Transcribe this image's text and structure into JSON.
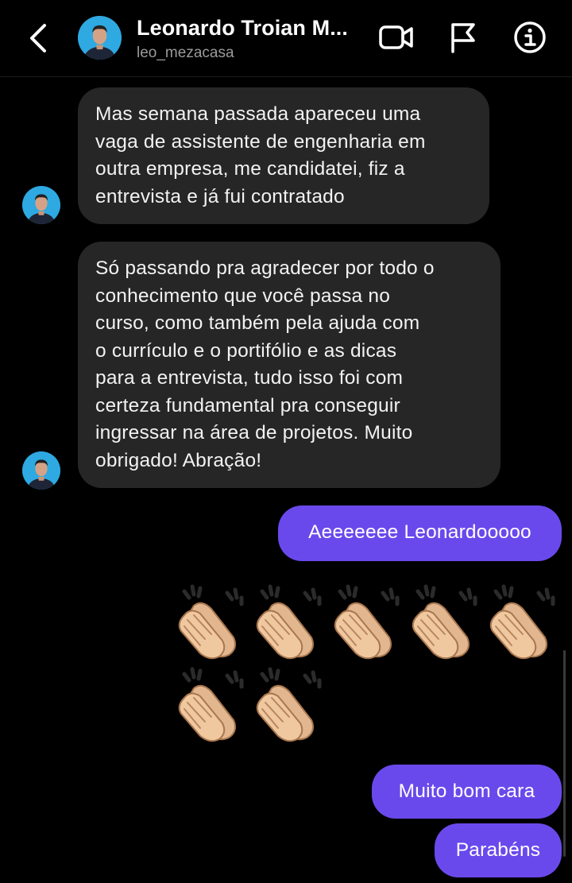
{
  "header": {
    "contact_name": "Leonardo Troian M...",
    "username": "leo_mezacasa",
    "icons": {
      "back": "chevron-left-icon",
      "video": "video-camera-icon",
      "flag": "flag-icon",
      "info": "info-icon"
    }
  },
  "messages": {
    "incoming": [
      {
        "text": "Mas semana passada apareceu uma\nvaga de assistente de engenharia em\noutra empresa, me candidatei, fiz a\nentrevista e já fui contratado"
      },
      {
        "text": "Só passando pra agradecer por todo o\nconhecimento que você passa no\ncurso, como também pela ajuda com\no currículo e o portifólio e as dicas\npara a entrevista, tudo isso foi com\ncerteza fundamental pra conseguir\ningressar na área de projetos. Muito\nobrigado! Abração!"
      }
    ],
    "outgoing": [
      {
        "text": "Aeeeeeee Leonardooooo"
      },
      {
        "text": "Muito bom cara"
      },
      {
        "text": "Parabéns"
      }
    ],
    "emoji_message": {
      "emoji": "clapping-hands",
      "count": 7
    }
  },
  "colors": {
    "background": "#000000",
    "incoming_bubble": "#262626",
    "outgoing_bubble": "#6a49ec",
    "username_gray": "#9b9b9b"
  }
}
